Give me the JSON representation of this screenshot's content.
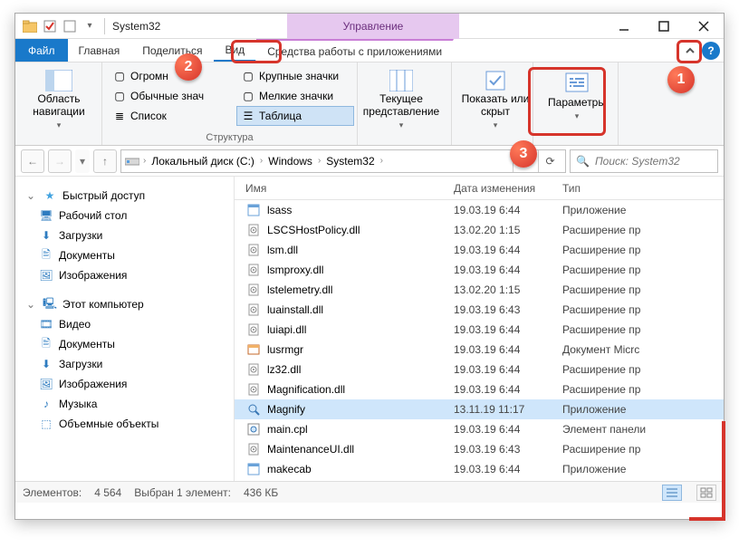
{
  "title": "System32",
  "context_tab": "Управление",
  "tabs": {
    "file": "Файл",
    "home": "Главная",
    "share": "Поделиться",
    "view": "Вид",
    "apptools": "Средства работы с приложениями"
  },
  "ribbon": {
    "nav_pane": "Область навигации",
    "layouts": {
      "xl": "Огромн",
      "med": "Обычные знач",
      "list": "Список",
      "big": "Крупные значки",
      "small": "Мелкие значки",
      "table": "Таблица"
    },
    "layout_group": "Структура",
    "current_view": "Текущее представление",
    "show_hide": "Показать или скрыт",
    "options": "Параметры"
  },
  "breadcrumbs": [
    "Локальный диск (C:)",
    "Windows",
    "System32"
  ],
  "search_placeholder": "Поиск: System32",
  "columns": {
    "name": "Имя",
    "date": "Дата изменения",
    "type": "Тип"
  },
  "tree": {
    "quick": "Быстрый доступ",
    "quick_items": [
      "Рабочий стол",
      "Загрузки",
      "Документы",
      "Изображения"
    ],
    "pc": "Этот компьютер",
    "pc_items": [
      "Видео",
      "Документы",
      "Загрузки",
      "Изображения",
      "Музыка",
      "Объемные объекты"
    ]
  },
  "files": [
    {
      "name": "lsass",
      "date": "19.03.19 6:44",
      "type": "Приложение",
      "icon": "app",
      "sel": false
    },
    {
      "name": "LSCSHostPolicy.dll",
      "date": "13.02.20 1:15",
      "type": "Расширение пр",
      "icon": "dll",
      "sel": false
    },
    {
      "name": "lsm.dll",
      "date": "19.03.19 6:44",
      "type": "Расширение пр",
      "icon": "dll",
      "sel": false
    },
    {
      "name": "lsmproxy.dll",
      "date": "19.03.19 6:44",
      "type": "Расширение пр",
      "icon": "dll",
      "sel": false
    },
    {
      "name": "lstelemetry.dll",
      "date": "13.02.20 1:15",
      "type": "Расширение пр",
      "icon": "dll",
      "sel": false
    },
    {
      "name": "luainstall.dll",
      "date": "19.03.19 6:43",
      "type": "Расширение пр",
      "icon": "dll",
      "sel": false
    },
    {
      "name": "luiapi.dll",
      "date": "19.03.19 6:44",
      "type": "Расширение пр",
      "icon": "dll",
      "sel": false
    },
    {
      "name": "lusrmgr",
      "date": "19.03.19 6:44",
      "type": "Документ Micrс",
      "icon": "msc",
      "sel": false
    },
    {
      "name": "lz32.dll",
      "date": "19.03.19 6:44",
      "type": "Расширение пр",
      "icon": "dll",
      "sel": false
    },
    {
      "name": "Magnification.dll",
      "date": "19.03.19 6:44",
      "type": "Расширение пр",
      "icon": "dll",
      "sel": false
    },
    {
      "name": "Magnify",
      "date": "13.11.19 11:17",
      "type": "Приложение",
      "icon": "mag",
      "sel": true
    },
    {
      "name": "main.cpl",
      "date": "19.03.19 6:44",
      "type": "Элемент панели",
      "icon": "cpl",
      "sel": false
    },
    {
      "name": "MaintenanceUI.dll",
      "date": "19.03.19 6:43",
      "type": "Расширение пр",
      "icon": "dll",
      "sel": false
    },
    {
      "name": "makecab",
      "date": "19.03.19 6:44",
      "type": "Приложение",
      "icon": "app",
      "sel": false
    }
  ],
  "status": {
    "count_label": "Элементов:",
    "count": "4 564",
    "sel_label": "Выбран 1 элемент:",
    "sel_size": "436 КБ"
  },
  "callouts": {
    "n1": "1",
    "n2": "2",
    "n3": "3"
  }
}
